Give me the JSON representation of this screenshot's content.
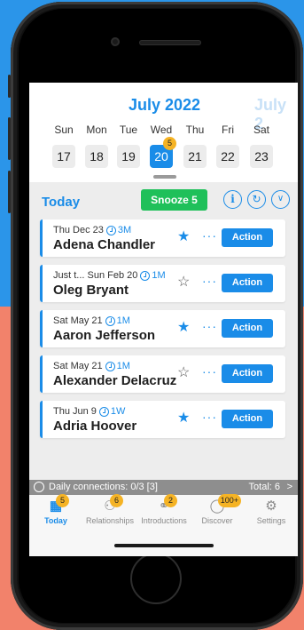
{
  "calendar": {
    "month_title": "July 2022",
    "next_month_title": "July 2",
    "days": [
      {
        "name": "Sun",
        "date": "17"
      },
      {
        "name": "Mon",
        "date": "18"
      },
      {
        "name": "Tue",
        "date": "19"
      },
      {
        "name": "Wed",
        "date": "20",
        "badge": "5",
        "selected": true
      },
      {
        "name": "Thu",
        "date": "21"
      },
      {
        "name": "Fri",
        "date": "22"
      },
      {
        "name": "Sat",
        "date": "23"
      }
    ]
  },
  "toolbar": {
    "title": "Today",
    "snooze_label": "Snooze 5",
    "icons": [
      "info-icon",
      "refresh-icon",
      "chevron-down-icon"
    ]
  },
  "contacts": [
    {
      "meta": "Thu Dec 23",
      "freq": "3M",
      "name": "Adena Chandler",
      "starred": true,
      "action": "Action"
    },
    {
      "meta": "Just t...  Sun Feb 20",
      "freq": "1M",
      "name": "Oleg Bryant",
      "starred": false,
      "action": "Action"
    },
    {
      "meta": "Sat May 21",
      "freq": "1M",
      "name": "Aaron Jefferson",
      "starred": true,
      "action": "Action"
    },
    {
      "meta": "Sat May 21",
      "freq": "1M",
      "name": "Alexander Delacruz",
      "starred": false,
      "action": "Action"
    },
    {
      "meta": "Thu Jun 9",
      "freq": "1W",
      "name": "Adria Hoover",
      "starred": true,
      "action": "Action"
    }
  ],
  "daily_bar": {
    "text": "Daily connections: 0/3 [3]",
    "total": "Total: 6",
    "chevron": ">"
  },
  "tabs": [
    {
      "label": "Today",
      "badge": "5",
      "icon": "calendar-icon",
      "active": true
    },
    {
      "label": "Relationships",
      "badge": "6",
      "icon": "people-icon",
      "active": false
    },
    {
      "label": "Introductions",
      "badge": "2",
      "icon": "handshake-icon",
      "active": false
    },
    {
      "label": "Discover",
      "badge": "100+",
      "icon": "compass-icon",
      "active": false
    },
    {
      "label": "Settings",
      "badge": "",
      "icon": "gear-icon",
      "active": false
    }
  ],
  "colors": {
    "accent": "#1a8ce8",
    "snooze": "#1fc05a",
    "badge": "#f5b324",
    "background_top": "#2b95e9",
    "background_bottom": "#f2826b"
  }
}
